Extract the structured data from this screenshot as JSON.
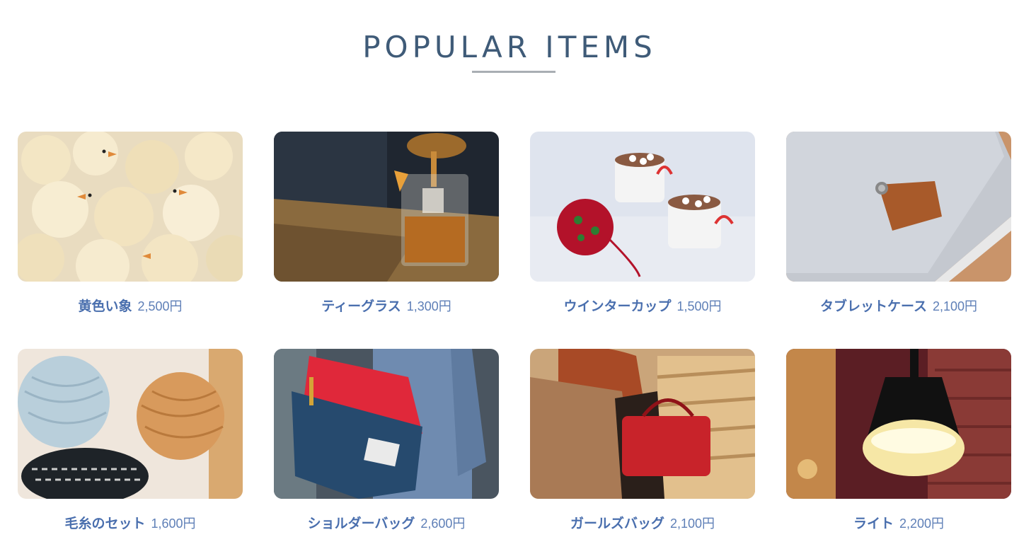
{
  "section": {
    "title": "POPULAR ITEMS"
  },
  "items": [
    {
      "name": "黄色い象",
      "price": "2,500円",
      "image": "yellow-chicks-photo"
    },
    {
      "name": "ティーグラス",
      "price": "1,300円",
      "image": "tea-glass-photo"
    },
    {
      "name": "ウインターカップ",
      "price": "1,500円",
      "image": "winter-cup-photo"
    },
    {
      "name": "タブレットケース",
      "price": "2,100円",
      "image": "tablet-case-photo"
    },
    {
      "name": "毛糸のセット",
      "price": "1,600円",
      "image": "yarn-set-photo"
    },
    {
      "name": "ショルダーバッグ",
      "price": "2,600円",
      "image": "shoulder-bag-photo"
    },
    {
      "name": "ガールズバッグ",
      "price": "2,100円",
      "image": "girls-bag-photo"
    },
    {
      "name": "ライト",
      "price": "2,200円",
      "image": "light-photo"
    }
  ]
}
